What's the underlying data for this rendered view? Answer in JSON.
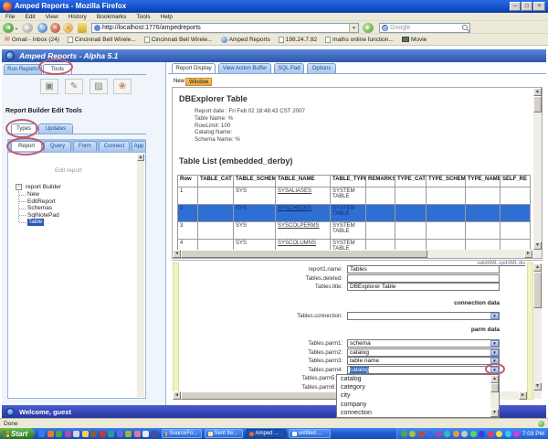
{
  "colors": {
    "titlebar_blue": "#1450c8",
    "app_header_blue": "#2c56ae",
    "tab_blue": "#a9c8ef",
    "selected_row_blue": "#2e6fd4",
    "selection_blue": "#316ac5",
    "highlight_orange": "#f5b84e",
    "annotation_red": "#c05a6e",
    "taskbar_blue": "#2158cc",
    "start_green": "#3a8e2e",
    "form_strip_yellow": "#f2f2c6",
    "status_bar_blue": "#2636a0"
  },
  "browser": {
    "window_title": "Amped Reports - Mozilla Firefox",
    "menu": [
      "File",
      "Edit",
      "View",
      "History",
      "Bookmarks",
      "Tools",
      "Help"
    ],
    "url": "http://localhost:1776/ampedreports",
    "search_label": "Google",
    "bookmarks": [
      "Gmail - Inbox (24)",
      "Cincinnati Bell Wirele...",
      "Cincinnati Bell Wirele...",
      "Amped Reports",
      "198.24.7.82",
      "maths online function...",
      "Movie"
    ],
    "status": "Done"
  },
  "app": {
    "header_title": "Amped Reports  - Alpha 5.1",
    "left_tabs": {
      "run_reports": "Run Reports",
      "tools": "Tools"
    },
    "section_title": "Report Builder Edit Tools",
    "type_tabs": {
      "types": "Types",
      "updates": "Updates"
    },
    "edit_tabs": {
      "report": "Report",
      "query": "Query",
      "form": "Form",
      "connect": "Connect",
      "app": "App"
    },
    "tree": {
      "caption": "Edit report",
      "root": "report Builder",
      "items": [
        "New",
        "EditReport",
        "Schemas",
        "SqlNotePad",
        "Table"
      ],
      "selected": "Table"
    },
    "right_tabs": [
      "Report Display",
      "View Action Buffer",
      "SQL Pad",
      "Options"
    ],
    "new_label": "New",
    "window_label": "Window",
    "report": {
      "title": "DBExplorer Table",
      "meta": [
        "Report date : Fri Feb 02 18:48:43 CST 2007",
        "Table Name: %",
        "RowLimit: 100",
        "Catalog Name:",
        "Schema Name: %"
      ],
      "table_title": "Table List (embedded_derby)",
      "columns": [
        "Row",
        "TABLE_CAT",
        "TABLE_SCHEM",
        "TABLE_NAME",
        "TABLE_TYPE",
        "REMARKS",
        "TYPE_CAT",
        "TYPE_SCHEM",
        "TYPE_NAME",
        "SELF_RE"
      ],
      "rows": [
        {
          "row": "1",
          "table_cat": "",
          "table_schem": "SYS",
          "table_name": "SYSALIASES",
          "table_type": "SYSTEM TABLE"
        },
        {
          "row": "2",
          "table_cat": "",
          "table_schem": "SYS",
          "table_name": "SYSCHECKS",
          "table_type": "SYSTEM TABLE"
        },
        {
          "row": "3",
          "table_cat": "",
          "table_schem": "SYS",
          "table_name": "SYSCOLPERMS",
          "table_type": "SYSTEM TABLE"
        },
        {
          "row": "4",
          "table_cat": "",
          "table_schem": "SYS",
          "table_name": "SYSCOLUMNS",
          "table_type": "SYSTEM TABLE"
        }
      ]
    },
    "form": {
      "links": "validXML  updXML  dis",
      "name_label": "report1.name:",
      "name_value": "Tables",
      "deleted_label": "Tables.deleted:",
      "deleted_value": "",
      "title_label": "Tables.title:",
      "title_value": "DBExplorer Table",
      "connection_section": "connection data",
      "connection_label": "Tables.connection:",
      "connection_value": "",
      "parm_section": "parm data",
      "parm_labels": [
        "Tables.parm1:",
        "Tables.parm2:",
        "Tables.parm3:",
        "Tables.parm4:",
        "Tables.parm5:",
        "Tables.parm6:"
      ],
      "parm_values": [
        "schema",
        "catalog",
        "table name",
        "catalog",
        "",
        ""
      ],
      "dropdown_options": [
        "catalog",
        "category",
        "city",
        "company",
        "connection"
      ]
    },
    "status": "Welcome, guest"
  },
  "taskbar": {
    "start_label": "Start",
    "tasks": [
      "SourceFo...",
      "Sent Ite...",
      "Amped ...",
      "untitled ..."
    ],
    "clock": "7:03 PM"
  }
}
